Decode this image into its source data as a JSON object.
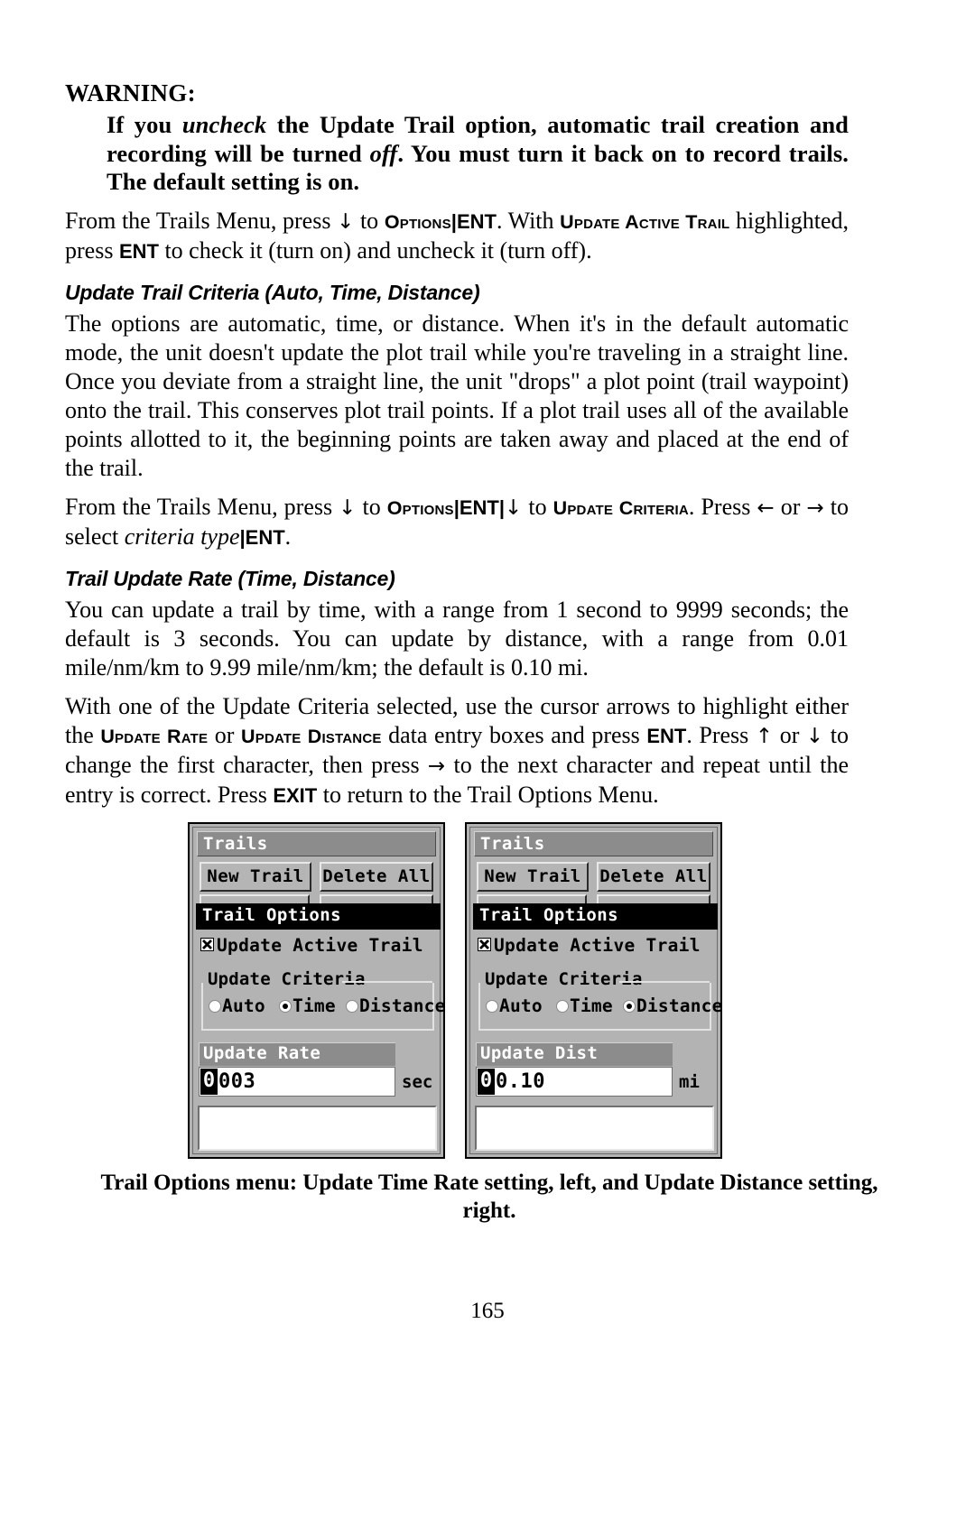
{
  "warning": {
    "heading": "WARNING:",
    "body_parts": [
      {
        "t": "If you ",
        "style": "b"
      },
      {
        "t": "uncheck",
        "style": "bi"
      },
      {
        "t": " the Update Trail option, automatic trail creation and recording will be turned ",
        "style": "b"
      },
      {
        "t": "off",
        "style": "bi"
      },
      {
        "t": ". You must turn it back on to record trails. The default setting is on.",
        "style": "b"
      }
    ]
  },
  "paragraphs": {
    "p1_a": "From the Trails Menu, press ",
    "p1_arrow": "↓",
    "p1_b": " to ",
    "p1_options": "Options",
    "p1_bar1": "|",
    "p1_ent": "ENT",
    "p1_c": ". With ",
    "p1_update_active_trail": "Update Active Trail",
    "p1_d": " highlighted, press ",
    "p1_ent2": "ENT",
    "p1_e": " to check it (turn on) and uncheck it (turn off).",
    "h_criteria": "Update Trail Criteria (Auto, Time, Distance)",
    "p2": "The options are automatic, time, or distance. When it's in the default automatic mode, the unit doesn't update the plot trail while you're traveling in a straight line. Once you deviate from a straight line, the unit \"drops\" a plot point (trail waypoint) onto the trail. This conserves plot trail points. If a plot trail uses all of the available points allotted to it, the beginning points are taken away and placed at the end of the trail.",
    "p3_a": "From the Trails Menu, press ",
    "p3_arrow1": "↓",
    "p3_b": " to ",
    "p3_options": "Options",
    "p3_bar1": "|",
    "p3_ent": "ENT",
    "p3_bar2": "|",
    "p3_arrow2": "↓",
    "p3_c": " to ",
    "p3_update_criteria": "Update Criteria",
    "p3_d": ". Press ",
    "p3_arrow_left": "←",
    "p3_e": " or ",
    "p3_arrow_right": "→",
    "p3_f": " to select ",
    "p3_criteria_type": "criteria type",
    "p3_bar3": "|",
    "p3_ent2": "ENT",
    "p3_g": ".",
    "h_rate": "Trail Update Rate (Time, Distance)",
    "p4": "You can update a trail by time, with a range from 1 second to 9999 seconds; the default is 3 seconds. You can update by distance, with a range from 0.01 mile/nm/km to 9.99 mile/nm/km; the default is 0.10 mi.",
    "p5_a": "With one of the Update Criteria selected, use the cursor arrows to highlight either the ",
    "p5_update_rate": "Update Rate",
    "p5_b": " or ",
    "p5_update_distance": "Update Distance",
    "p5_c": " data entry boxes and press ",
    "p5_ent": "ENT",
    "p5_d": ". Press ",
    "p5_arrow_up": "↑",
    "p5_e": " or ",
    "p5_arrow_down": "↓",
    "p5_f": " to change the first character, then press ",
    "p5_arrow_right": "→",
    "p5_g": " to the next character and repeat until the entry is correct. Press ",
    "p5_exit": "EXIT",
    "p5_h": " to return to the Trail Options Menu."
  },
  "screenshots": [
    {
      "title": "Trails",
      "button_new_trail": "New Trail",
      "button_delete_all": "Delete All",
      "options_header": "Trail Options",
      "checkbox_label": "Update Active Trail",
      "checkbox_checked": true,
      "criteria_legend": "Update Criteria",
      "radios": [
        {
          "label": "Auto",
          "selected": false
        },
        {
          "label": "Time",
          "selected": true
        },
        {
          "label": "Distance",
          "selected": false
        }
      ],
      "entry_header": "Update Rate",
      "entry_highlight_char": "0",
      "entry_rest": "003",
      "entry_unit": "sec"
    },
    {
      "title": "Trails",
      "button_new_trail": "New Trail",
      "button_delete_all": "Delete All",
      "options_header": "Trail Options",
      "checkbox_label": "Update Active Trail",
      "checkbox_checked": true,
      "criteria_legend": "Update Criteria",
      "radios": [
        {
          "label": "Auto",
          "selected": false
        },
        {
          "label": "Time",
          "selected": false
        },
        {
          "label": "Distance",
          "selected": true
        }
      ],
      "entry_header": "Update Dist",
      "entry_highlight_char": "0",
      "entry_rest": "0.10",
      "entry_unit": "mi"
    }
  ],
  "caption": "Trail Options menu: Update Time Rate setting, left, and Update Distance setting, right.",
  "page_number": "165",
  "colors": {
    "lcd_background": "#b3b3b3",
    "lcd_titlebar": "#8c8c8c",
    "lcd_header_black": "#000000",
    "lcd_white": "#ffffff"
  }
}
